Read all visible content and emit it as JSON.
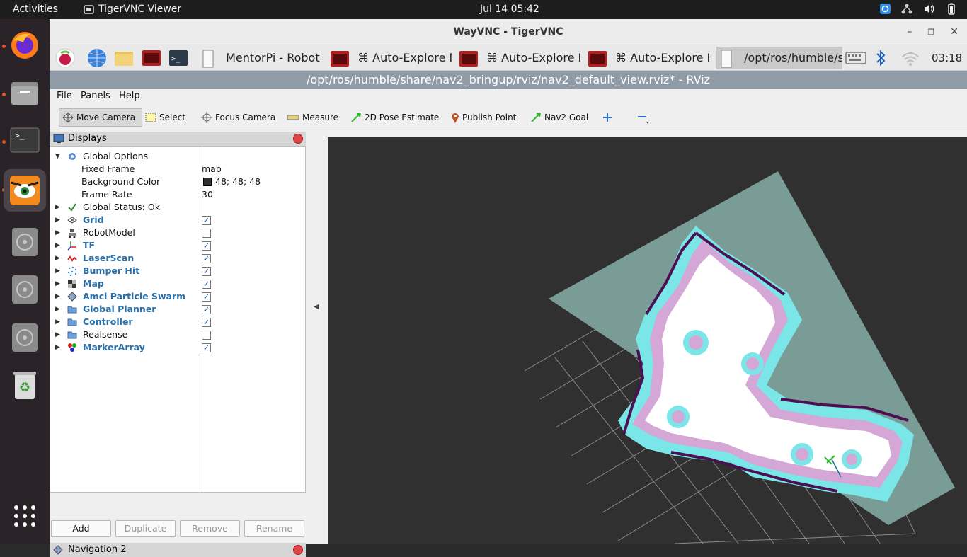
{
  "topbar": {
    "activities": "Activities",
    "app_name": "TigerVNC Viewer",
    "clock": "Jul 14  05:42"
  },
  "dock": {
    "items": [
      "firefox-icon",
      "files-icon",
      "terminal-icon",
      "tigervnc-icon",
      "disc-icon",
      "disc-icon",
      "disc-icon",
      "trash-icon",
      "app-grid-icon"
    ]
  },
  "vnc": {
    "title": "WayVNC - TigerVNC",
    "taskbar": {
      "tasks": [
        "MentorPi - Robot ..",
        "⌘ Auto-Explore M..",
        "⌘ Auto-Explore M..",
        "⌘ Auto-Explore M..",
        "/opt/ros/humble/s.."
      ],
      "time": "03:18"
    },
    "rviz_title": "/opt/ros/humble/share/nav2_bringup/rviz/nav2_default_view.rviz* - RViz"
  },
  "menu": [
    "File",
    "Panels",
    "Help"
  ],
  "toolbar": [
    "Move Camera",
    "Select",
    "Focus Camera",
    "Measure",
    "2D Pose Estimate",
    "Publish Point",
    "Nav2 Goal"
  ],
  "displays": {
    "title": "Displays",
    "global_options": "Global Options",
    "fixed_frame_label": "Fixed Frame",
    "fixed_frame_value": "map",
    "bg_color_label": "Background Color",
    "bg_color_value": "48; 48; 48",
    "frame_rate_label": "Frame Rate",
    "frame_rate_value": "30",
    "global_status": "Global Status: Ok",
    "items": [
      {
        "label": "Grid",
        "checked": true
      },
      {
        "label": "RobotModel",
        "checked": false
      },
      {
        "label": "TF",
        "checked": true
      },
      {
        "label": "LaserScan",
        "checked": true
      },
      {
        "label": "Bumper Hit",
        "checked": true
      },
      {
        "label": "Map",
        "checked": true
      },
      {
        "label": "Amcl Particle Swarm",
        "checked": true
      },
      {
        "label": "Global Planner",
        "checked": true
      },
      {
        "label": "Controller",
        "checked": true
      },
      {
        "label": "Realsense",
        "checked": false
      },
      {
        "label": "MarkerArray",
        "checked": true
      }
    ],
    "buttons": [
      "Add",
      "Duplicate",
      "Remove",
      "Rename"
    ]
  },
  "navigation_panel": "Navigation 2",
  "colors": {
    "viewport_bg": "#303030",
    "map_unknown": "#7a9c97",
    "costmap_cyan": "#7ae6e8",
    "costmap_pink": "#d4a7d6",
    "obstacle": "#4c0f52"
  }
}
